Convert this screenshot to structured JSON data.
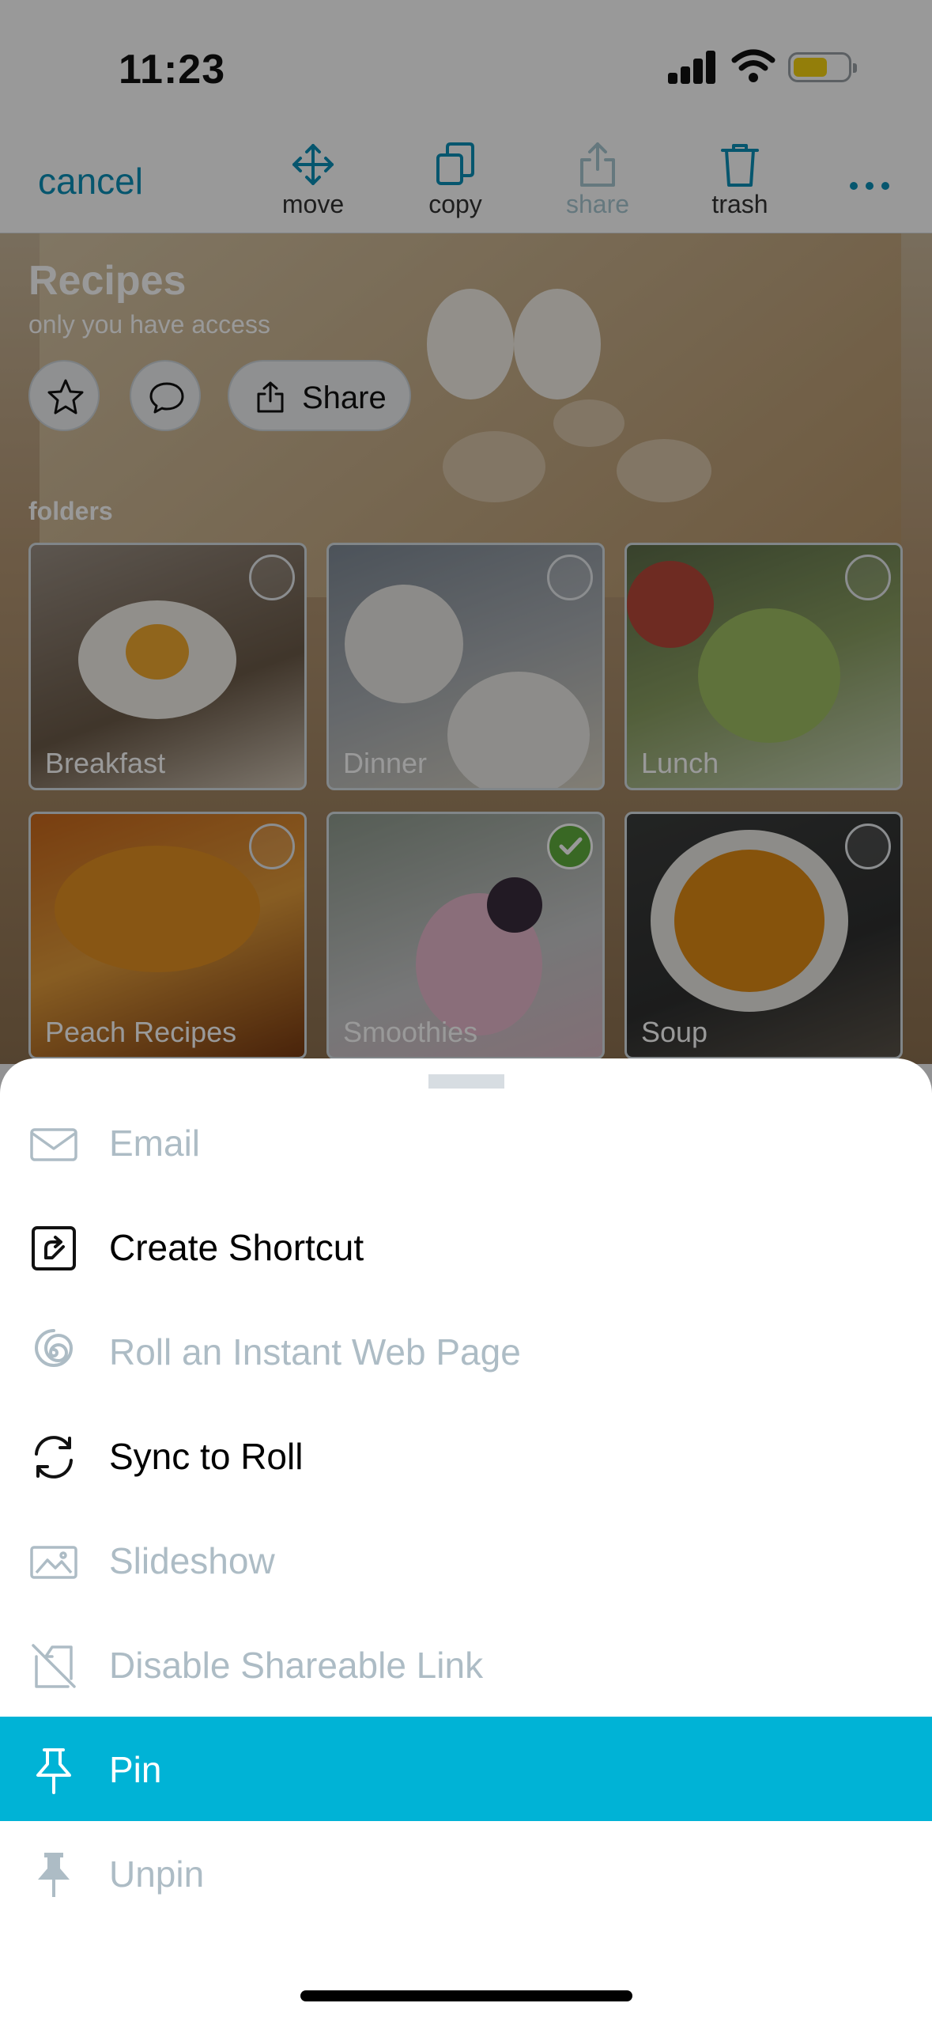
{
  "status_bar": {
    "time": "11:23"
  },
  "toolbar": {
    "cancel": "cancel",
    "move": "move",
    "copy": "copy",
    "share": "share",
    "trash": "trash"
  },
  "page": {
    "title": "Recipes",
    "subtitle": "only you have access",
    "share_button": "Share",
    "folders_label": "folders"
  },
  "folders": [
    {
      "name": "Breakfast",
      "selected": false
    },
    {
      "name": "Dinner",
      "selected": false
    },
    {
      "name": "Lunch",
      "selected": false
    },
    {
      "name": "Peach Recipes",
      "selected": false
    },
    {
      "name": "Smoothies",
      "selected": true
    },
    {
      "name": "Soup",
      "selected": false
    }
  ],
  "sheet": {
    "items": [
      {
        "label": "Email",
        "icon": "envelope-icon",
        "enabled": false
      },
      {
        "label": "Create Shortcut",
        "icon": "shortcut-icon",
        "enabled": true
      },
      {
        "label": "Roll an Instant Web Page",
        "icon": "spiral-icon",
        "enabled": false
      },
      {
        "label": "Sync to Roll",
        "icon": "sync-icon",
        "enabled": true
      },
      {
        "label": "Slideshow",
        "icon": "image-icon",
        "enabled": false
      },
      {
        "label": "Disable Shareable Link",
        "icon": "link-off-icon",
        "enabled": false
      },
      {
        "label": "Pin",
        "icon": "pin-icon",
        "enabled": true,
        "highlighted": true
      },
      {
        "label": "Unpin",
        "icon": "unpin-icon",
        "enabled": false
      }
    ]
  },
  "colors": {
    "accent": "#00b3d6",
    "link": "#0a8fb8",
    "check": "#5fae3d"
  }
}
